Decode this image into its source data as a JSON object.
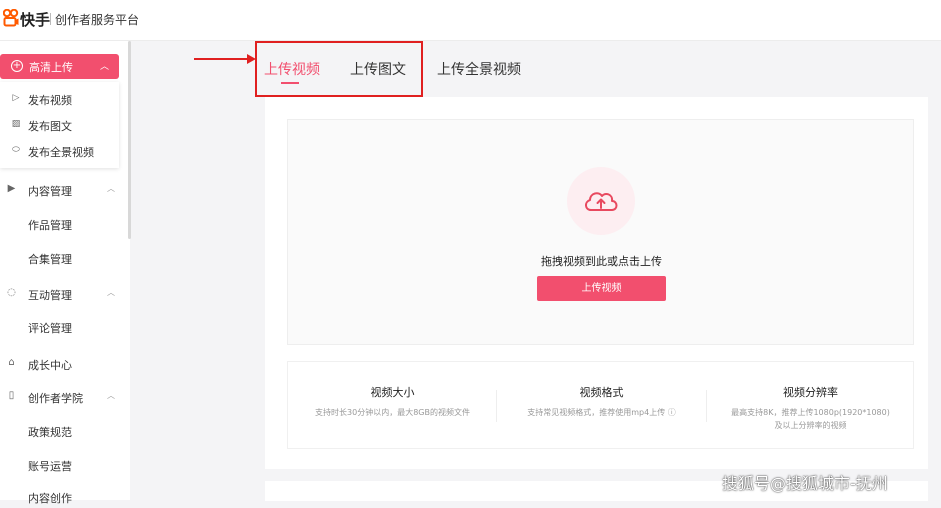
{
  "header": {
    "logo_text": "快手",
    "platform": "创作者服务平台"
  },
  "sidebar": {
    "upload_button": "高清上传",
    "upload_items": [
      {
        "label": "发布视频",
        "icon": "play-circle-icon"
      },
      {
        "label": "发布图文",
        "icon": "image-icon"
      },
      {
        "label": "发布全景视频",
        "icon": "panorama-icon"
      }
    ],
    "sections": [
      {
        "label": "内容管理",
        "icon": "play-square-icon",
        "expanded": true
      },
      {
        "label": "作品管理",
        "child": true
      },
      {
        "label": "合集管理",
        "child": true
      },
      {
        "label": "互动管理",
        "icon": "chat-icon",
        "expanded": true
      },
      {
        "label": "评论管理",
        "child": true
      },
      {
        "label": "成长中心",
        "icon": "growth-icon"
      },
      {
        "label": "创作者学院",
        "icon": "book-icon",
        "expanded": true
      },
      {
        "label": "政策规范",
        "child": true
      },
      {
        "label": "账号运营",
        "child": true
      },
      {
        "label": "内容创作",
        "child": true
      }
    ]
  },
  "tabs": [
    {
      "label": "上传视频",
      "active": true
    },
    {
      "label": "上传图文",
      "active": false
    },
    {
      "label": "上传全景视频",
      "active": false
    }
  ],
  "dropzone": {
    "text": "拖拽视频到此或点击上传",
    "button": "上传视频",
    "icon": "cloud-upload-icon"
  },
  "specs": [
    {
      "title": "视频大小",
      "desc": "支持时长30分钟以内，最大8GB的视频文件"
    },
    {
      "title": "视频格式",
      "desc": "支持常见视频格式，推荐使用mp4上传"
    },
    {
      "title": "视频分辨率",
      "desc": "最高支持8K，推荐上传1080p(1920*1080)",
      "desc2": "及以上分辨率的视频"
    }
  ],
  "watermark": "搜狐号@搜狐城市-抚州",
  "colors": {
    "accent": "#f24f6e",
    "annotation": "#e02020"
  }
}
